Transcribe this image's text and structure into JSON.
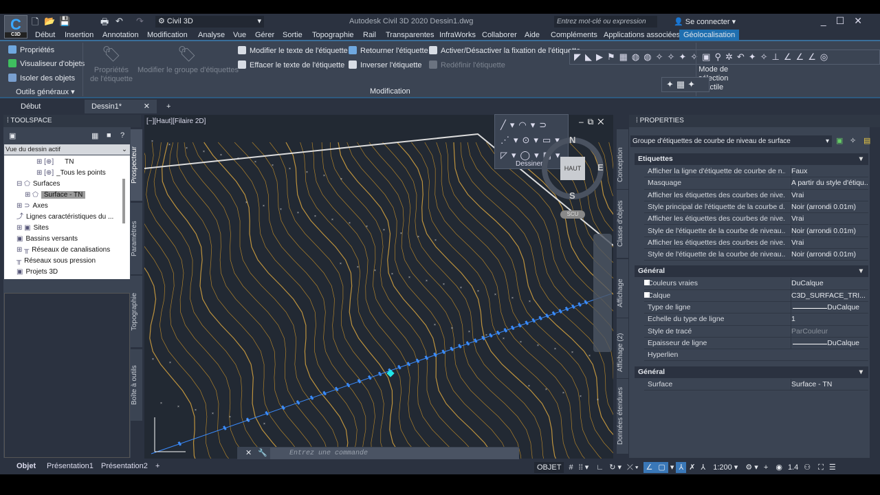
{
  "app": {
    "logo": "C",
    "logo_sub": "C3D",
    "workspace": "Civil 3D",
    "title": "Autodesk Civil 3D 2020   Dessin1.dwg",
    "search_placeholder": "Entrez mot-clé ou expression",
    "sign_in": "Se connecter"
  },
  "menu": [
    "Début",
    "Insertion",
    "Annotation",
    "Modification",
    "Analyse",
    "Vue",
    "Gérer",
    "Sortie",
    "Topographie",
    "Rail",
    "Transparentes",
    "InfraWorks",
    "Collaborer",
    "Aide",
    "Compléments",
    "Applications associées",
    "Géolocalisation"
  ],
  "ribbon": {
    "general": {
      "items": [
        "Propriétés",
        "Visualiseur d'objets",
        "Isoler des objets"
      ],
      "panel": "Outils généraux"
    },
    "label_props": "Propriétés de l'étiquette",
    "edit_group": "Modifier le groupe d'étiquettes",
    "mod": [
      "Modifier le texte de l'étiquette",
      "Effacer le texte de l'étiquette",
      "Retourner l'étiquette",
      "Inverser l'étiquette",
      "Activer/Désactiver la fixation de l'étiquette",
      "Redéfinir l'étiquette"
    ],
    "mod_panel": "Modification",
    "touch": [
      "Mode de",
      "sélection",
      "tactile"
    ]
  },
  "doc_tabs": [
    "Début",
    "Dessin1*"
  ],
  "toolspace": {
    "title": "TOOLSPACE",
    "view": "Vue du dessin actif",
    "tree": [
      "TN",
      "_Tous les points",
      "Surfaces",
      "Surface - TN",
      "Axes",
      "Lignes caractéristiques du ...",
      "Sites",
      "Bassins versants",
      "Réseaux de canalisations",
      "Réseaux sous pression",
      "Projets 3D"
    ],
    "tabs": [
      "Prospecteur",
      "Paramètres",
      "Topographie",
      "Boîte à outils"
    ]
  },
  "viewport": {
    "label": "[−][Haut][Filaire 2D]",
    "draw_panel": "Dessiner",
    "compass": {
      "n": "N",
      "s": "S",
      "e": "E",
      "top": "HAUT",
      "ucs": "SCU"
    },
    "command_placeholder": "Entrez une commande"
  },
  "properties": {
    "title": "PROPERTIES",
    "selection": "Groupe d'étiquettes de courbe de niveau de surface",
    "tabs": [
      "Conception",
      "Classe d'objets",
      "Affichage",
      "Affichage (2)",
      "Données étendues"
    ],
    "sections": [
      {
        "name": "Etiquettes",
        "rows": [
          [
            "Afficher la ligne d'étiquette de courbe de n...",
            "Faux"
          ],
          [
            "Masquage",
            "A partir du style d'étiqu..."
          ],
          [
            "Afficher les étiquettes des courbes de nive...",
            "Vrai"
          ],
          [
            "Style principal de l'étiquette de la courbe d...",
            "Noir (arrondi 0.01m)"
          ],
          [
            "Afficher les étiquettes des courbes de nive...",
            "Vrai"
          ],
          [
            "Style de l'étiquette de la courbe de niveau...",
            "Noir (arrondi 0.01m)"
          ],
          [
            "Afficher les étiquettes des courbes de nive...",
            "Vrai"
          ],
          [
            "Style de l'étiquette de la courbe de niveau...",
            "Noir (arrondi 0.01m)"
          ]
        ]
      },
      {
        "name": "Général",
        "rows": [
          [
            "Couleurs vraies",
            "DuCalque"
          ],
          [
            "Calque",
            "C3D_SURFACE_TRI..."
          ],
          [
            "Type de ligne",
            "DuCalque"
          ],
          [
            "Echelle du type de ligne",
            "1"
          ],
          [
            "Style de tracé",
            "ParCouleur"
          ],
          [
            "Epaisseur de ligne",
            "DuCalque"
          ],
          [
            "Hyperlien",
            ""
          ]
        ]
      },
      {
        "name": "Général",
        "rows": [
          [
            "Surface",
            "Surface - TN"
          ]
        ]
      }
    ]
  },
  "status": {
    "layout_tabs": [
      "Objet",
      "Présentation1",
      "Présentation2"
    ],
    "model": "OBJET",
    "scale": "1:200",
    "value": "1.4"
  },
  "colors": {
    "accent": "#1f6fb0",
    "contour": "#c8922a",
    "alignment": "#3a8cff"
  }
}
